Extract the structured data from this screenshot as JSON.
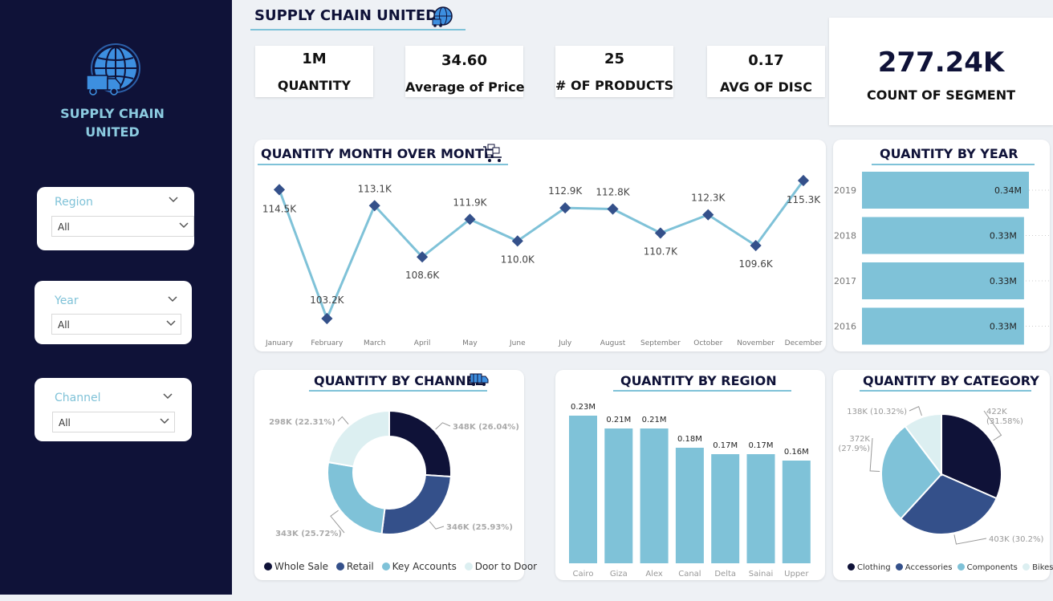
{
  "sidebar": {
    "brand": "SUPPLY CHAIN UNITED",
    "slicers": [
      {
        "title": "Region",
        "value": "All"
      },
      {
        "title": "Year",
        "value": "All"
      },
      {
        "title": "Channel",
        "value": "All"
      }
    ]
  },
  "header": {
    "title": "SUPPLY CHAIN UNITED"
  },
  "kpis": [
    {
      "value": "1M",
      "label": "QUANTITY"
    },
    {
      "value": "34.60",
      "label": "Average of Price"
    },
    {
      "value": "25",
      "label": "# OF PRODUCTS"
    },
    {
      "value": "0.17",
      "label": "AVG OF DISC"
    },
    {
      "value": "277.24K",
      "label": "COUNT OF SEGMENT"
    }
  ],
  "colors": {
    "navy": "#0f1238",
    "accent": "#7fc2d8",
    "mid": "#34508a",
    "pale": "#dceff1"
  },
  "chart_data": [
    {
      "type": "line",
      "title": "QUANTITY MONTH OVER MONTH",
      "categories": [
        "January",
        "February",
        "March",
        "April",
        "May",
        "June",
        "July",
        "August",
        "September",
        "October",
        "November",
        "December"
      ],
      "values": [
        114.5,
        103.2,
        113.1,
        108.6,
        111.9,
        110.0,
        112.9,
        112.8,
        110.7,
        112.3,
        109.6,
        115.3
      ],
      "labels": [
        "114.5K",
        "103.2K",
        "113.1K",
        "108.6K",
        "111.9K",
        "110.0K",
        "112.9K",
        "112.8K",
        "110.7K",
        "112.3K",
        "109.6K",
        "115.3K"
      ],
      "ylim": [
        103.2,
        115.3
      ]
    },
    {
      "type": "bar",
      "title": "QUANTITY BY YEAR",
      "categories": [
        "2019",
        "2018",
        "2017",
        "2016"
      ],
      "values": [
        0.34,
        0.33,
        0.33,
        0.33
      ],
      "labels": [
        "0.34M",
        "0.33M",
        "0.33M",
        "0.33M"
      ]
    },
    {
      "type": "pie",
      "title": "QUANTITY BY CHANNEL",
      "categories": [
        "Whole Sale",
        "Retail",
        "Key Accounts",
        "Door to Door"
      ],
      "values": [
        26.04,
        25.93,
        25.72,
        22.31
      ],
      "labels": [
        "348K (26.04%)",
        "346K (25.93%)",
        "343K (25.72%)",
        "298K (22.31%)"
      ],
      "colors": [
        "#0f1238",
        "#34508a",
        "#7fc2d8",
        "#dceff1"
      ]
    },
    {
      "type": "bar",
      "title": "QUANTITY BY REGION",
      "categories": [
        "Cairo",
        "Giza",
        "Alex",
        "Canal",
        "Delta",
        "Sainai",
        "Upper"
      ],
      "values": [
        0.23,
        0.21,
        0.21,
        0.18,
        0.17,
        0.17,
        0.16
      ],
      "labels": [
        "0.23M",
        "0.21M",
        "0.21M",
        "0.18M",
        "0.17M",
        "0.17M",
        "0.16M"
      ]
    },
    {
      "type": "pie",
      "title": "QUANTITY BY CATEGORY",
      "categories": [
        "Clothing",
        "Accessories",
        "Components",
        "Bikes"
      ],
      "values": [
        31.58,
        30.2,
        27.9,
        10.32
      ],
      "labels": [
        "422K (31.58%)",
        "403K (30.2%)",
        "372K (27.9%)",
        "138K (10.32%)"
      ],
      "colors": [
        "#0f1238",
        "#34508a",
        "#7fc2d8",
        "#dceff1"
      ]
    }
  ]
}
